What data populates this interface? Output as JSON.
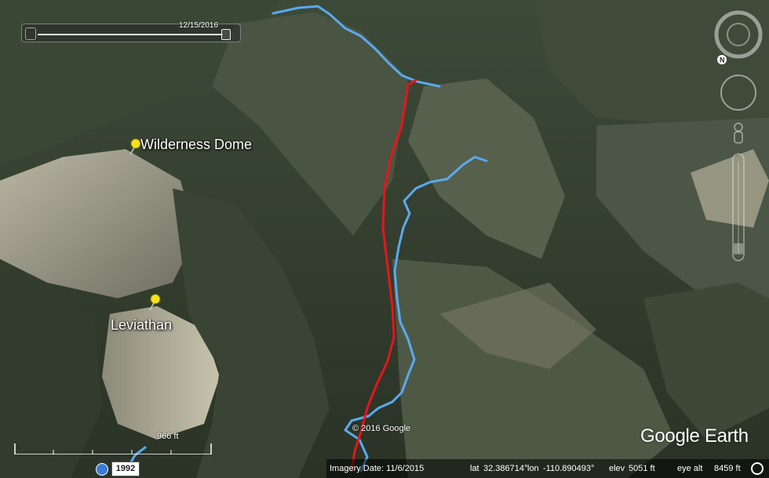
{
  "timeline": {
    "date": "12/15/2016"
  },
  "placemarks": [
    {
      "name": "Wilderness Dome"
    },
    {
      "name": "Leviathan"
    }
  ],
  "navigation": {
    "north_label": "N"
  },
  "scale_bar": {
    "label": "966 ft"
  },
  "historical_imagery": {
    "year": "1992"
  },
  "copyright": "© 2016 Google",
  "brand": "Google Earth",
  "status_bar": {
    "imagery_date": "Imagery Date: 11/6/2015",
    "lat_label": "lat",
    "lat": "32.386714°",
    "lon_label": "lon",
    "lon": "-110.890493°",
    "elev_label": "elev",
    "elev": "5051 ft",
    "eye_label": "eye alt",
    "eye": "8459 ft"
  },
  "colors": {
    "route": "#e8141c",
    "gps_track": "#5aa9ee",
    "placemark": "#f2e21c"
  },
  "icons": [
    "pushpin-icon",
    "compass-ring-icon",
    "look-joystick-icon",
    "move-joystick-icon",
    "pegman-icon",
    "zoom-slider-icon",
    "clock-icon",
    "status-indicator-icon"
  ]
}
